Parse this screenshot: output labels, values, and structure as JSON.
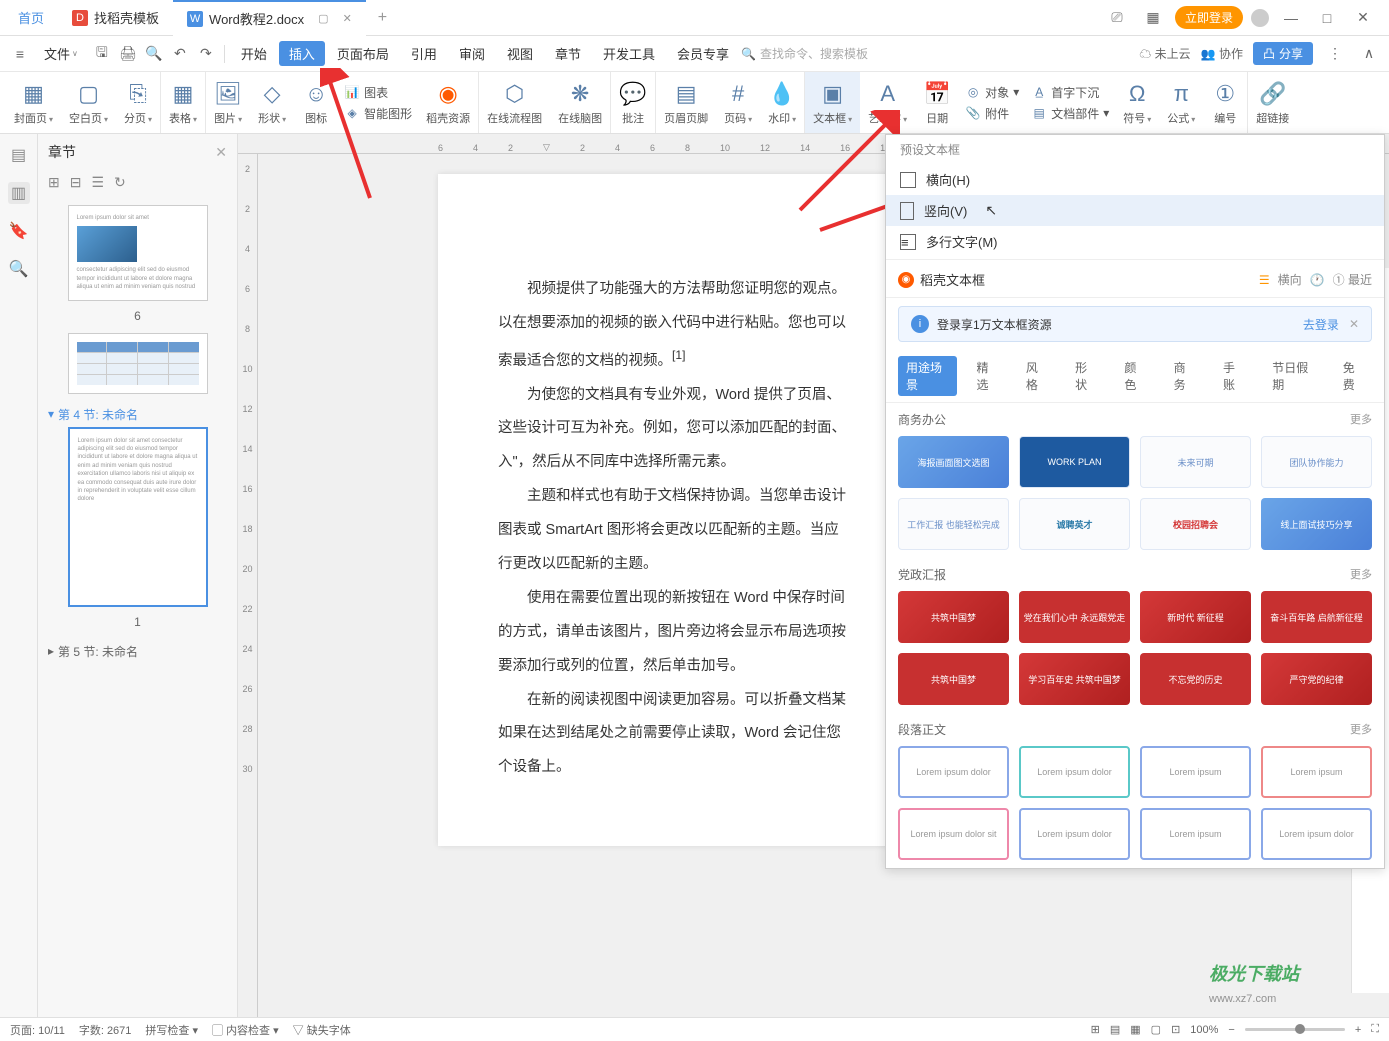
{
  "titlebar": {
    "home": "首页",
    "tab1": "找稻壳模板",
    "tab2": "Word教程2.docx",
    "login": "立即登录"
  },
  "menubar": {
    "file": "文件",
    "items": [
      "开始",
      "插入",
      "页面布局",
      "引用",
      "审阅",
      "视图",
      "章节",
      "开发工具",
      "会员专享"
    ],
    "search_placeholder": "查找命令、搜索模板",
    "cloud": "未上云",
    "coop": "协作",
    "share": "分享"
  },
  "ribbon": {
    "cover": "封面页",
    "blank": "空白页",
    "break": "分页",
    "table": "表格",
    "picture": "图片",
    "shape": "形状",
    "icon": "图标",
    "chart": "图表",
    "smart": "智能图形",
    "resource": "稻壳资源",
    "flow": "在线流程图",
    "mind": "在线脑图",
    "comment": "批注",
    "header": "页眉页脚",
    "pageno": "页码",
    "watermark": "水印",
    "textbox": "文本框",
    "wordart": "艺术字",
    "date": "日期",
    "obj": "对象",
    "attach": "附件",
    "dropcap": "首字下沉",
    "docpart": "文档部件",
    "symbol": "符号",
    "formula": "公式",
    "number": "编号",
    "hyperlink": "超链接"
  },
  "sidebar": {
    "title": "章节",
    "page6": "6",
    "section4": "第 4 节: 未命名",
    "page1": "1",
    "section5": "第 5 节: 未命名"
  },
  "document": {
    "p1": "视频提供了功能强大的方法帮助您证明您的观点。",
    "p2": "以在想要添加的视频的嵌入代码中进行粘贴。您也可以",
    "p3": "索最适合您的文档的视频。",
    "sup": "[1]",
    "p4": "为使您的文档具有专业外观，Word 提供了页眉、",
    "p5": "这些设计可互为补充。例如，您可以添加匹配的封面、",
    "p6": "入\"，然后从不同库中选择所需元素。",
    "p7": "主题和样式也有助于文档保持协调。当您单击设计",
    "p8": "图表或 SmartArt 图形将会更改以匹配新的主题。当应",
    "p9": "行更改以匹配新的主题。",
    "p10": "使用在需要位置出现的新按钮在 Word 中保存时间",
    "p11": "的方式，请单击该图片，图片旁边将会显示布局选项按",
    "p12": "要添加行或列的位置，然后单击加号。",
    "p13": "在新的阅读视图中阅读更加容易。可以折叠文档某",
    "p14": "如果在达到结尾处之前需要停止读取，Word 会记住您",
    "p15": "个设备上。"
  },
  "dropdown": {
    "preset": "预设文本框",
    "horizontal": "横向(H)",
    "vertical": "竖向(V)",
    "multiline": "多行文字(M)",
    "docer": "稻壳文本框",
    "horiz_link": "横向",
    "recent": "最近",
    "login_banner": "登录享1万文本框资源",
    "login_action": "去登录",
    "categories": [
      "用途场景",
      "精选",
      "风格",
      "形状",
      "颜色",
      "商务",
      "手账",
      "节日假期",
      "免费"
    ],
    "sec1": "商务办公",
    "more": "更多",
    "sec2": "党政汇报",
    "sec3": "段落正文",
    "t1": "海报画面图文选图",
    "t2": "",
    "t3": "未来可期",
    "t4": "团队协作能力",
    "t5": "工作汇报 也能轻松完成",
    "t6": "诚聘英才",
    "t7": "校园招聘会",
    "t8": "线上面试技巧分享",
    "r1": "共筑中国梦",
    "r2": "党在我们心中 永远跟党走",
    "r3": "新时代 新征程",
    "r4": "奋斗百年路 启航新征程",
    "r5": "共筑中国梦",
    "r6": "学习百年史 共筑中国梦",
    "r7": "不忘党的历史",
    "r8": "严守党的纪律"
  },
  "statusbar": {
    "page": "页面: 10/11",
    "words": "字数: 2671",
    "spellcheck": "拼写检查",
    "contentcheck": "内容检查",
    "missingfont": "缺失字体",
    "zoom": "100%"
  },
  "watermark": "极光下载站",
  "watermark_url": "www.xz7.com"
}
